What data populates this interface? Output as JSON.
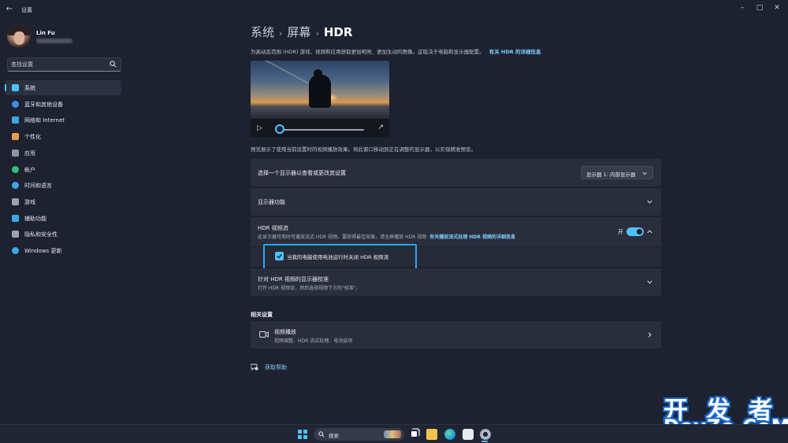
{
  "window": {
    "title": "设置",
    "back_icon": "back-arrow-icon",
    "controls": [
      "minimize-icon",
      "maximize-icon",
      "close-icon"
    ]
  },
  "user": {
    "name": "Lin Fu"
  },
  "search": {
    "placeholder": "查找设置",
    "icon": "search-icon"
  },
  "sidebar": {
    "items": [
      {
        "label": "系统",
        "icon": "monitor-icon",
        "color": "#4cc2ff",
        "active": true
      },
      {
        "label": "蓝牙和其他设备",
        "icon": "bluetooth-icon",
        "color": "#3a8ee6"
      },
      {
        "label": "网络和 Internet",
        "icon": "wifi-icon",
        "color": "#3aa7e6"
      },
      {
        "label": "个性化",
        "icon": "brush-icon",
        "color": "#e8a04a"
      },
      {
        "label": "应用",
        "icon": "apps-icon",
        "color": "#8a95a8"
      },
      {
        "label": "帐户",
        "icon": "account-icon",
        "color": "#2fc07a"
      },
      {
        "label": "时间和语言",
        "icon": "globe-clock-icon",
        "color": "#3aa7e6"
      },
      {
        "label": "游戏",
        "icon": "gamepad-icon",
        "color": "#9aa3b3"
      },
      {
        "label": "辅助功能",
        "icon": "accessibility-icon",
        "color": "#3aa7e6"
      },
      {
        "label": "隐私和安全性",
        "icon": "shield-icon",
        "color": "#9aa3b3"
      },
      {
        "label": "Windows 更新",
        "icon": "update-icon",
        "color": "#3aa7e6"
      }
    ]
  },
  "breadcrumb": {
    "items": [
      "系统",
      "屏幕"
    ],
    "current": "HDR",
    "separator": "›"
  },
  "description": {
    "text": "为高动态范围 (HDR) 游戏、视频和应用获取更加明亮、更加生动的图像。这取决于电脑和显示器配置。",
    "link": "有关 HDR 的详细信息"
  },
  "preview": {
    "note": "预览展示了使用当前设置时的视频播放效果。将此窗口移动到正在调整的显示器，以实现精准预览。",
    "play_icon": "play-icon",
    "fullscreen_icon": "fullscreen-icon",
    "progress": 0.0
  },
  "display_select": {
    "title": "选择一个显示器以查看或更改其设置",
    "selected": "显示器 1: 内部显示器"
  },
  "display_capabilities": {
    "title": "显示器功能"
  },
  "hdr_video": {
    "title": "HDR 视频流",
    "subtitle": "此显示器可用时可播放流式 HDR 视频。要获得最佳效果，请全屏播放 HDR 视频",
    "link": "有关播放流式处理 HDR 视频的详细信息",
    "toggle_label": "开",
    "toggle_on": true,
    "battery_option": "当我的电脑使用电池运行时关闭 HDR 视频流",
    "battery_checked": true
  },
  "calibration": {
    "title": "针对 HDR 视频的显示器校准",
    "subtitle": "打开 HDR 视频流，然后选择视频下方的\"校准\"。"
  },
  "related": {
    "header": "相关设置",
    "video_playback": {
      "title": "视频播放",
      "subtitle": "视频调整、HDR 流式处理、电池选项"
    }
  },
  "help": {
    "label": "获取帮助"
  },
  "watermark": {
    "line1": "开 发 者",
    "line2": "DevZe.CoM"
  },
  "taskbar": {
    "search_label": "搜索",
    "apps": [
      "start-icon",
      "task-view-icon",
      "file-explorer-icon",
      "edge-icon",
      "store-icon",
      "settings-icon"
    ]
  },
  "colors": {
    "accent": "#4cc2ff",
    "background": "#1d2130",
    "card": "#2a2e3c",
    "highlight_border": "#2aa6f2"
  }
}
